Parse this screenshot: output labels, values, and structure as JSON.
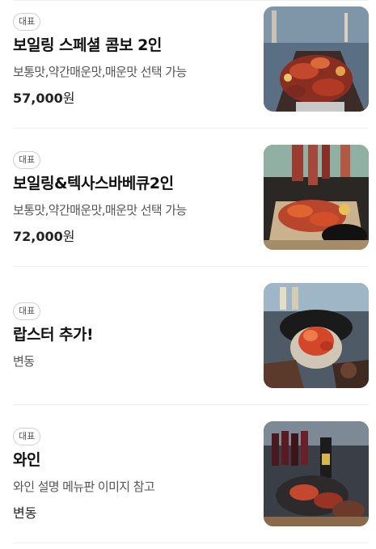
{
  "menu": {
    "items": [
      {
        "badge": "대표",
        "name": "보일링 스페셜 콤보 2인",
        "description": "보통맛,약간매운맛,매운맛 선택 가능",
        "price": "57,000",
        "currency": "원",
        "image": "seafood-platter-photo"
      },
      {
        "badge": "대표",
        "name": "보일링&텍사스바베큐2인",
        "description": "보통맛,약간매운맛,매운맛 선택 가능",
        "price": "72,000",
        "currency": "원",
        "image": "seafood-bbq-photo"
      },
      {
        "badge": "대표",
        "name": "랍스터 추가!",
        "description": "변동",
        "image": "lobster-photo"
      },
      {
        "badge": "대표",
        "name": "와인",
        "description": "와인 설명 메뉴판 이미지 참고",
        "price_text": "변동",
        "image": "wine-photo"
      }
    ]
  },
  "colors": {
    "badge_border": "#cfcfcf",
    "divider": "#efefef",
    "text_primary": "#111111",
    "text_secondary": "#555555"
  }
}
